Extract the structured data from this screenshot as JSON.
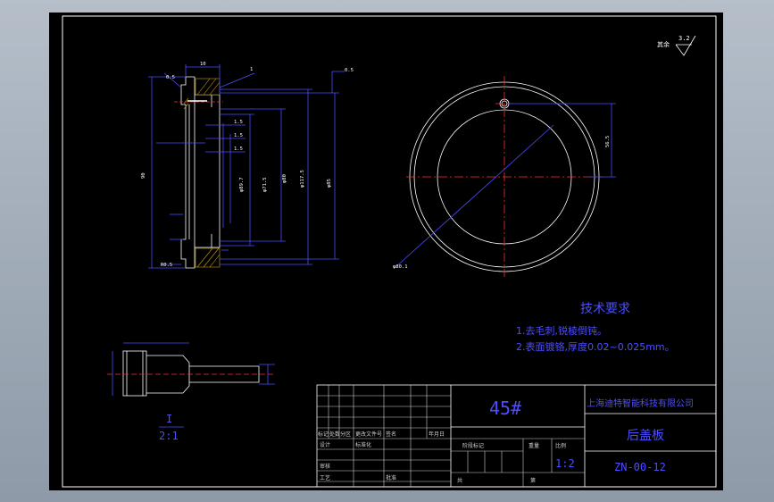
{
  "drawing": {
    "material": "45#",
    "company": "上海迪特智能科技有限公司",
    "part_name": "后盖板",
    "drawing_number": "ZN-00-12",
    "scale": "1:2",
    "detail_label": "I",
    "detail_scale": "2:1",
    "surface_symbol_prefix": "其余",
    "surface_roughness": "3.2",
    "tech_req_title": "技术要求",
    "tech_req_1": "1.去毛刺,锐棱倒钝。",
    "tech_req_2": "2.表面镀铬,厚度0.02~0.025mm。"
  },
  "title_block": {
    "row_labels": [
      "标记",
      "处数",
      "分区",
      "更改文件号",
      "签名",
      "年月日"
    ],
    "designer": "设计",
    "standardization": "标准化",
    "review": "审核",
    "process": "工艺",
    "approve": "批准",
    "stage_mark": "阶段标记",
    "weight": "重量",
    "scale_label": "比例",
    "sheets_total": "共",
    "sheet_no": "第"
  },
  "dimensions": {
    "top_width": "10",
    "leader_I": "1",
    "chamfer": "0.5",
    "top_right": "0.5",
    "d1": "1.5",
    "d2": "1.5",
    "d3": "1.5",
    "dia_a": "φ89.7",
    "dia_b": "φ71.5",
    "dia_c": "φ80",
    "dia_d": "φ117.5",
    "dia_e": "φ85",
    "left_height": "90",
    "bottom_r": "R0.5",
    "front_dia": "φ80.1",
    "front_offset": "56.5"
  }
}
